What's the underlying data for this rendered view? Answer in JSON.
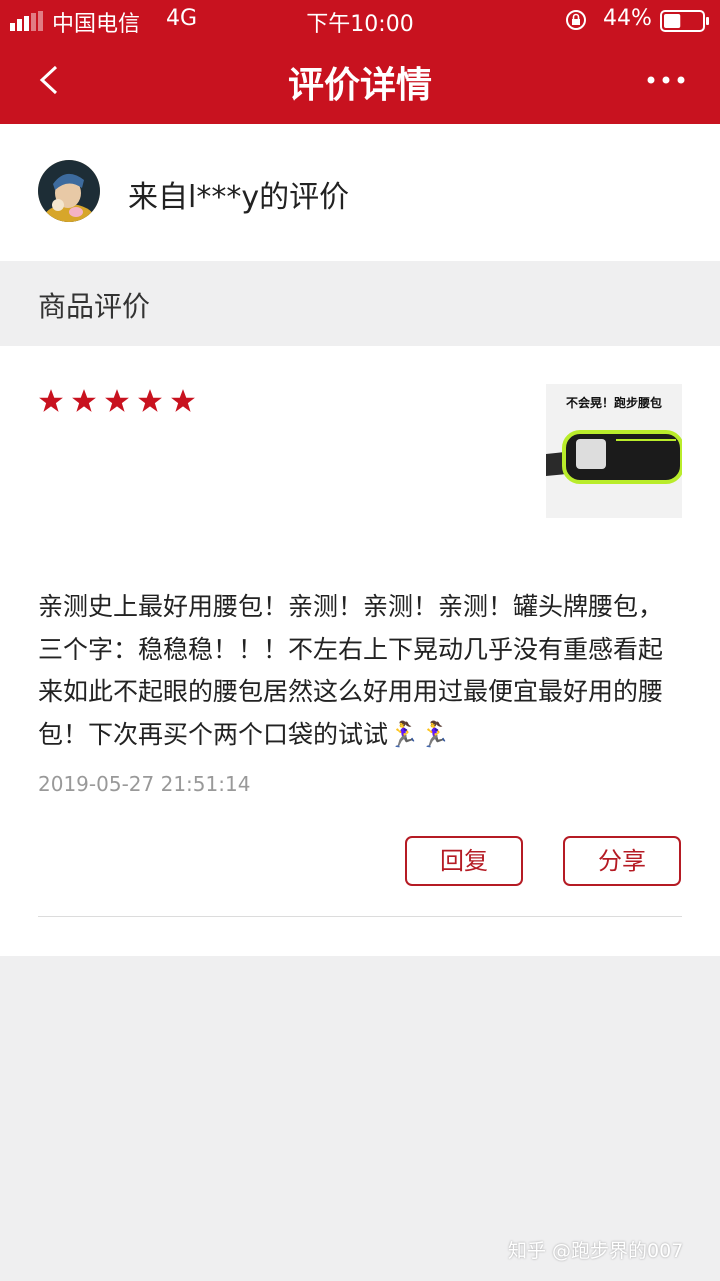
{
  "status_bar": {
    "carrier": "中国电信",
    "network": "4G",
    "time": "下午10:00",
    "battery_percent": "44%",
    "battery_level": 0.44
  },
  "nav": {
    "title": "评价详情",
    "back_icon": "chevron-left-icon",
    "more_icon": "more-dots-icon"
  },
  "reviewer": {
    "name_text": "来自l***y的评价"
  },
  "section": {
    "title": "商品评价"
  },
  "review": {
    "rating": 5,
    "rating_max": 5,
    "text": "亲测史上最好用腰包！亲测！亲测！亲测！罐头牌腰包，三个字：稳稳稳！！！不左右上下晃动几乎没有重感看起来如此不起眼的腰包居然这么好用用过最便宜最好用的腰包！下次再买个两个口袋的试试🏃‍♀️🏃‍♀️",
    "date": "2019-05-27 21:51:14",
    "product_image_caption": "不会晃！跑步腰包"
  },
  "actions": {
    "reply_label": "回复",
    "share_label": "分享"
  },
  "watermark": "知乎 @跑步界的007",
  "colors": {
    "brand_red": "#c8121f",
    "star_red": "#c8121f",
    "button_red": "#b51b24",
    "background": "#efeff0"
  }
}
